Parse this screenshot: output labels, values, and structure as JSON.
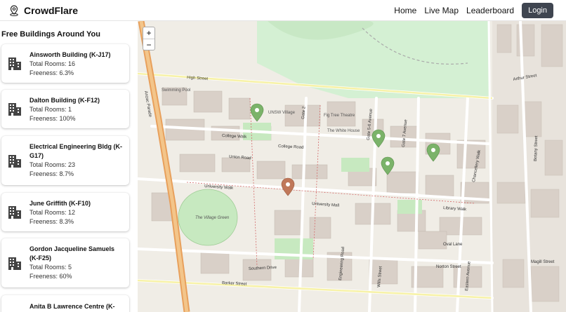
{
  "header": {
    "app_name": "CrowdFlare",
    "nav": [
      {
        "label": "Home"
      },
      {
        "label": "Live Map"
      },
      {
        "label": "Leaderboard"
      }
    ],
    "login_label": "Login"
  },
  "sidebar": {
    "title": "Free Buildings Around You",
    "buildings": [
      {
        "name": "Ainsworth Building (K-J17)",
        "rooms": "Total Rooms: 16",
        "freeness": "Freeness: 6.3%"
      },
      {
        "name": "Dalton Building (K-F12)",
        "rooms": "Total Rooms: 1",
        "freeness": "Freeness: 100%"
      },
      {
        "name": "Electrical Engineering Bldg (K-G17)",
        "rooms": "Total Rooms: 23",
        "freeness": "Freeness: 8.7%"
      },
      {
        "name": "June Griffith (K-F10)",
        "rooms": "Total Rooms: 12",
        "freeness": "Freeness: 8.3%"
      },
      {
        "name": "Gordon Jacqueline Samuels (K-F25)",
        "rooms": "Total Rooms: 5",
        "freeness": "Freeness: 60%"
      },
      {
        "name": "Anita B Lawrence Centre (K-",
        "rooms": "",
        "freeness": ""
      }
    ]
  },
  "map": {
    "zoom_in": "+",
    "zoom_out": "−",
    "labels": {
      "high_street": "High Street",
      "college_walk": "College Walk",
      "college_road": "College Road",
      "union_road": "Union Road",
      "university_walk": "University Walk",
      "university_mall": "University Mall",
      "library_walk": "Library Walk",
      "oval_lane": "Oval Lane",
      "norton_street": "Norton Street",
      "barker_street": "Barker Street",
      "southern_drive": "Southern Drive",
      "anzac_parade": "Anzac Parade",
      "botany_street": "Botany Street",
      "arthur_street": "Arthur Street",
      "the_village_green": "The Village Green",
      "engineering_road": "Engineering Road",
      "swimming_pool": "Swimming Pool",
      "magill_street": "Magill Street",
      "wills_street": "Wills Street",
      "eastern_avenue": "Eastern Avenue",
      "chancellery_walk": "Chancellery Walk",
      "gate_2": "Gate 2",
      "gate_5_6": "Gate 5-6 Avenue",
      "gate_7": "Gate 7 Avenue",
      "fig_tree_theatre": "Fig Tree Theatre",
      "the_white_house": "The White House",
      "unsw_village": "UNSW Village"
    },
    "pin_green": "#6aa84f",
    "pin_orange": "#c0785a"
  }
}
